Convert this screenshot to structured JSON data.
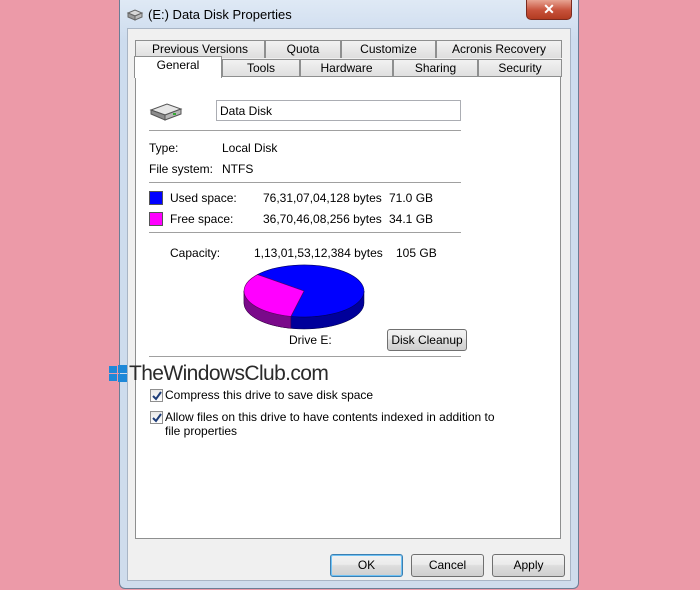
{
  "window": {
    "title": "(E:) Data Disk Properties",
    "close_label": "✕"
  },
  "tabs_row1": [
    "Previous Versions",
    "Quota",
    "Customize",
    "Acronis Recovery"
  ],
  "tabs_row2": [
    "General",
    "Tools",
    "Hardware",
    "Sharing",
    "Security"
  ],
  "active_tab": "General",
  "general": {
    "drive_name": "Data Disk",
    "type_label": "Type:",
    "type_value": "Local Disk",
    "fs_label": "File system:",
    "fs_value": "NTFS",
    "used_label": "Used space:",
    "used_bytes": "76,31,07,04,128 bytes",
    "used_size": "71.0 GB",
    "free_label": "Free space:",
    "free_bytes": "36,70,46,08,256 bytes",
    "free_size": "34.1 GB",
    "capacity_label": "Capacity:",
    "capacity_bytes": "1,13,01,53,12,384 bytes",
    "capacity_size": "105 GB",
    "drive_label": "Drive E:",
    "disk_cleanup_label": "Disk Cleanup",
    "compress_label": "Compress this drive to save disk space",
    "compress_checked": true,
    "index_label_line1": "Allow files on this drive to have contents indexed in addition to",
    "index_label_line2": "file properties",
    "index_checked": true,
    "used_fraction": 0.676
  },
  "colors": {
    "used": "#0000ff",
    "free": "#ff00ff",
    "arrow": "#b01818"
  },
  "icons": {
    "drive": "hard-drive-icon",
    "windows_logo": "windows-logo-icon"
  },
  "buttons": {
    "ok": "OK",
    "cancel": "Cancel",
    "apply": "Apply"
  },
  "watermark": "TheWindowsClub.com"
}
